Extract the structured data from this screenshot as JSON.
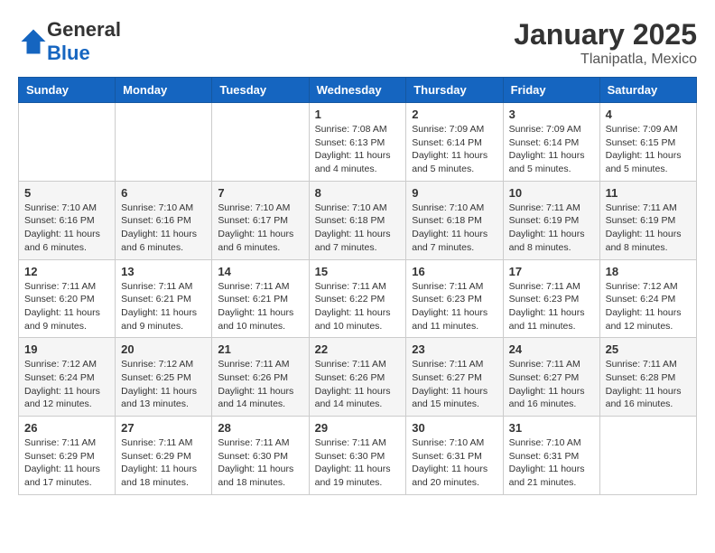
{
  "logo": {
    "general": "General",
    "blue": "Blue"
  },
  "header": {
    "month": "January 2025",
    "location": "Tlanipatla, Mexico"
  },
  "weekdays": [
    "Sunday",
    "Monday",
    "Tuesday",
    "Wednesday",
    "Thursday",
    "Friday",
    "Saturday"
  ],
  "weeks": [
    [
      {
        "day": "",
        "info": ""
      },
      {
        "day": "",
        "info": ""
      },
      {
        "day": "",
        "info": ""
      },
      {
        "day": "1",
        "info": "Sunrise: 7:08 AM\nSunset: 6:13 PM\nDaylight: 11 hours\nand 4 minutes."
      },
      {
        "day": "2",
        "info": "Sunrise: 7:09 AM\nSunset: 6:14 PM\nDaylight: 11 hours\nand 5 minutes."
      },
      {
        "day": "3",
        "info": "Sunrise: 7:09 AM\nSunset: 6:14 PM\nDaylight: 11 hours\nand 5 minutes."
      },
      {
        "day": "4",
        "info": "Sunrise: 7:09 AM\nSunset: 6:15 PM\nDaylight: 11 hours\nand 5 minutes."
      }
    ],
    [
      {
        "day": "5",
        "info": "Sunrise: 7:10 AM\nSunset: 6:16 PM\nDaylight: 11 hours\nand 6 minutes."
      },
      {
        "day": "6",
        "info": "Sunrise: 7:10 AM\nSunset: 6:16 PM\nDaylight: 11 hours\nand 6 minutes."
      },
      {
        "day": "7",
        "info": "Sunrise: 7:10 AM\nSunset: 6:17 PM\nDaylight: 11 hours\nand 6 minutes."
      },
      {
        "day": "8",
        "info": "Sunrise: 7:10 AM\nSunset: 6:18 PM\nDaylight: 11 hours\nand 7 minutes."
      },
      {
        "day": "9",
        "info": "Sunrise: 7:10 AM\nSunset: 6:18 PM\nDaylight: 11 hours\nand 7 minutes."
      },
      {
        "day": "10",
        "info": "Sunrise: 7:11 AM\nSunset: 6:19 PM\nDaylight: 11 hours\nand 8 minutes."
      },
      {
        "day": "11",
        "info": "Sunrise: 7:11 AM\nSunset: 6:19 PM\nDaylight: 11 hours\nand 8 minutes."
      }
    ],
    [
      {
        "day": "12",
        "info": "Sunrise: 7:11 AM\nSunset: 6:20 PM\nDaylight: 11 hours\nand 9 minutes."
      },
      {
        "day": "13",
        "info": "Sunrise: 7:11 AM\nSunset: 6:21 PM\nDaylight: 11 hours\nand 9 minutes."
      },
      {
        "day": "14",
        "info": "Sunrise: 7:11 AM\nSunset: 6:21 PM\nDaylight: 11 hours\nand 10 minutes."
      },
      {
        "day": "15",
        "info": "Sunrise: 7:11 AM\nSunset: 6:22 PM\nDaylight: 11 hours\nand 10 minutes."
      },
      {
        "day": "16",
        "info": "Sunrise: 7:11 AM\nSunset: 6:23 PM\nDaylight: 11 hours\nand 11 minutes."
      },
      {
        "day": "17",
        "info": "Sunrise: 7:11 AM\nSunset: 6:23 PM\nDaylight: 11 hours\nand 11 minutes."
      },
      {
        "day": "18",
        "info": "Sunrise: 7:12 AM\nSunset: 6:24 PM\nDaylight: 11 hours\nand 12 minutes."
      }
    ],
    [
      {
        "day": "19",
        "info": "Sunrise: 7:12 AM\nSunset: 6:24 PM\nDaylight: 11 hours\nand 12 minutes."
      },
      {
        "day": "20",
        "info": "Sunrise: 7:12 AM\nSunset: 6:25 PM\nDaylight: 11 hours\nand 13 minutes."
      },
      {
        "day": "21",
        "info": "Sunrise: 7:11 AM\nSunset: 6:26 PM\nDaylight: 11 hours\nand 14 minutes."
      },
      {
        "day": "22",
        "info": "Sunrise: 7:11 AM\nSunset: 6:26 PM\nDaylight: 11 hours\nand 14 minutes."
      },
      {
        "day": "23",
        "info": "Sunrise: 7:11 AM\nSunset: 6:27 PM\nDaylight: 11 hours\nand 15 minutes."
      },
      {
        "day": "24",
        "info": "Sunrise: 7:11 AM\nSunset: 6:27 PM\nDaylight: 11 hours\nand 16 minutes."
      },
      {
        "day": "25",
        "info": "Sunrise: 7:11 AM\nSunset: 6:28 PM\nDaylight: 11 hours\nand 16 minutes."
      }
    ],
    [
      {
        "day": "26",
        "info": "Sunrise: 7:11 AM\nSunset: 6:29 PM\nDaylight: 11 hours\nand 17 minutes."
      },
      {
        "day": "27",
        "info": "Sunrise: 7:11 AM\nSunset: 6:29 PM\nDaylight: 11 hours\nand 18 minutes."
      },
      {
        "day": "28",
        "info": "Sunrise: 7:11 AM\nSunset: 6:30 PM\nDaylight: 11 hours\nand 18 minutes."
      },
      {
        "day": "29",
        "info": "Sunrise: 7:11 AM\nSunset: 6:30 PM\nDaylight: 11 hours\nand 19 minutes."
      },
      {
        "day": "30",
        "info": "Sunrise: 7:10 AM\nSunset: 6:31 PM\nDaylight: 11 hours\nand 20 minutes."
      },
      {
        "day": "31",
        "info": "Sunrise: 7:10 AM\nSunset: 6:31 PM\nDaylight: 11 hours\nand 21 minutes."
      },
      {
        "day": "",
        "info": ""
      }
    ]
  ]
}
